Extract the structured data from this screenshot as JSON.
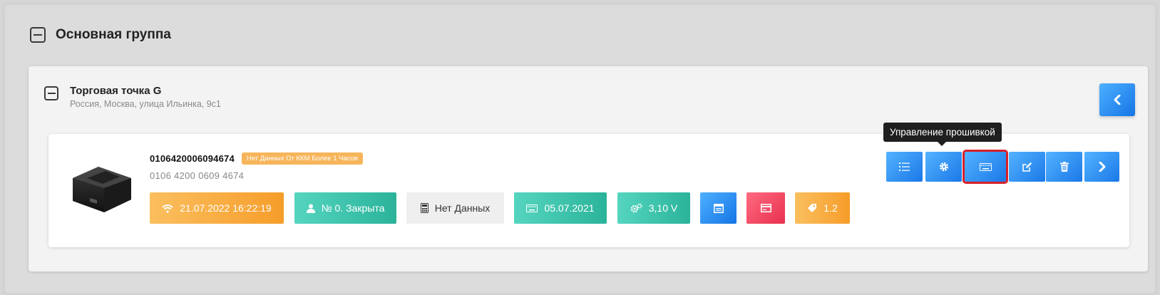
{
  "group": {
    "title": "Основная группа"
  },
  "store": {
    "title": "Торговая точка G",
    "address": "Россия, Москва, улица Ильинка, 9с1"
  },
  "device": {
    "serial": "0106420006094674",
    "warning_badge": "Нет Данных От ККМ Более 1 Часов",
    "serial_formatted": "0106 4200 0609 4674",
    "chips": {
      "last_connection": "21.07.2022 16:22:19",
      "shift": "№ 0. Закрыта",
      "fiscal": "Нет Данных",
      "firmware_date": "05.07.2021",
      "voltage": "3,10 V",
      "version": "1.2"
    }
  },
  "tooltip": {
    "text": "Управление прошивкой"
  },
  "icons": {
    "collapse": "minus-square-icon",
    "back": "chevron-left-icon",
    "wifi": "wifi-icon",
    "user": "user-icon",
    "calculator": "calculator-icon",
    "keyboard": "keyboard-icon",
    "gears": "gears-icon",
    "window": "window-icon",
    "card": "card-icon",
    "tag": "tag-icon",
    "list": "list-icon",
    "gear": "gear-icon",
    "edit": "edit-icon",
    "trash": "trash-icon",
    "next": "chevron-right-icon"
  },
  "colors": {
    "accent_blue": "#1575e6",
    "orange": "#f69d2a",
    "teal": "#2bb39a",
    "red": "#e8304f",
    "highlight": "#d8202a"
  }
}
